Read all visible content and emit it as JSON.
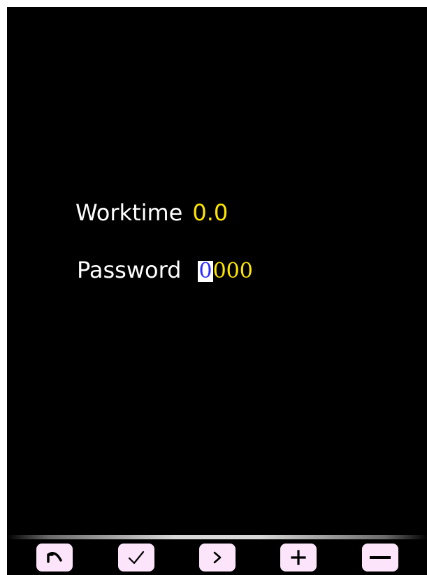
{
  "fields": {
    "worktime": {
      "label": "Worktime",
      "value": "0.0"
    },
    "password": {
      "label": "Password",
      "digits": [
        "0",
        "0",
        "0",
        "0"
      ],
      "active_digit_index": 0
    }
  },
  "toolbar": {
    "buttons": [
      {
        "name": "back",
        "icon": "undo-arrow-icon"
      },
      {
        "name": "confirm",
        "icon": "checkmark-icon"
      },
      {
        "name": "next",
        "icon": "chevron-right-icon"
      },
      {
        "name": "increment",
        "icon": "plus-icon"
      },
      {
        "name": "decrement",
        "icon": "minus-icon"
      }
    ]
  },
  "colors": {
    "background": "#000000",
    "label": "#ffffff",
    "value": "#ffe600",
    "active_digit_text": "#2b2bff",
    "active_digit_bg": "#ffffff",
    "button_bg": "#fce4fa"
  }
}
